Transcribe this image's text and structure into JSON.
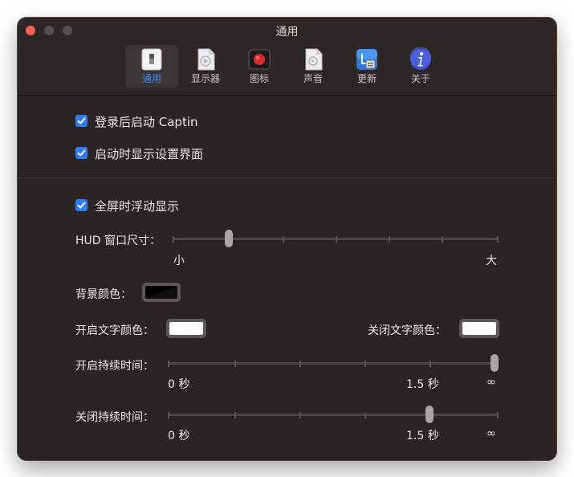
{
  "window": {
    "title": "通用"
  },
  "toolbar": {
    "tabs": [
      {
        "label": "通用",
        "icon": "switch-icon",
        "selected": true
      },
      {
        "label": "显示器",
        "icon": "document-play-icon",
        "selected": false
      },
      {
        "label": "图标",
        "icon": "record-icon",
        "selected": false
      },
      {
        "label": "声音",
        "icon": "audio-file-icon",
        "selected": false
      },
      {
        "label": "更新",
        "icon": "update-app-icon",
        "selected": false
      },
      {
        "label": "关于",
        "icon": "info-icon",
        "selected": false
      }
    ]
  },
  "general": {
    "launch_at_login": {
      "label": "登录后启动 Captin",
      "checked": true
    },
    "show_settings_on_launch": {
      "label": "启动时显示设置界面",
      "checked": true
    },
    "float_in_fullscreen": {
      "label": "全屏时浮动显示",
      "checked": true
    },
    "hud_size": {
      "label": "HUD 窗口尺寸：",
      "min_label": "小",
      "max_label": "大",
      "value_fraction": 0.17
    },
    "background_color": {
      "label": "背景颜色：",
      "value": "#000000"
    },
    "on_text_color": {
      "label": "开启文字颜色：",
      "value": "#ffffff"
    },
    "off_text_color": {
      "label": "关闭文字颜色：",
      "value": "#ffffff"
    },
    "on_duration": {
      "label": "开启持续时间：",
      "tick_min": "0 秒",
      "tick_mid": "1.5 秒",
      "tick_max": "∞",
      "value": "∞"
    },
    "off_duration": {
      "label": "关闭持续时间：",
      "tick_min": "0 秒",
      "tick_mid": "1.5 秒",
      "tick_max": "∞",
      "value": "1.5 秒"
    }
  },
  "colors": {
    "accent": "#2f7cf6",
    "close": "#ff5f57"
  }
}
